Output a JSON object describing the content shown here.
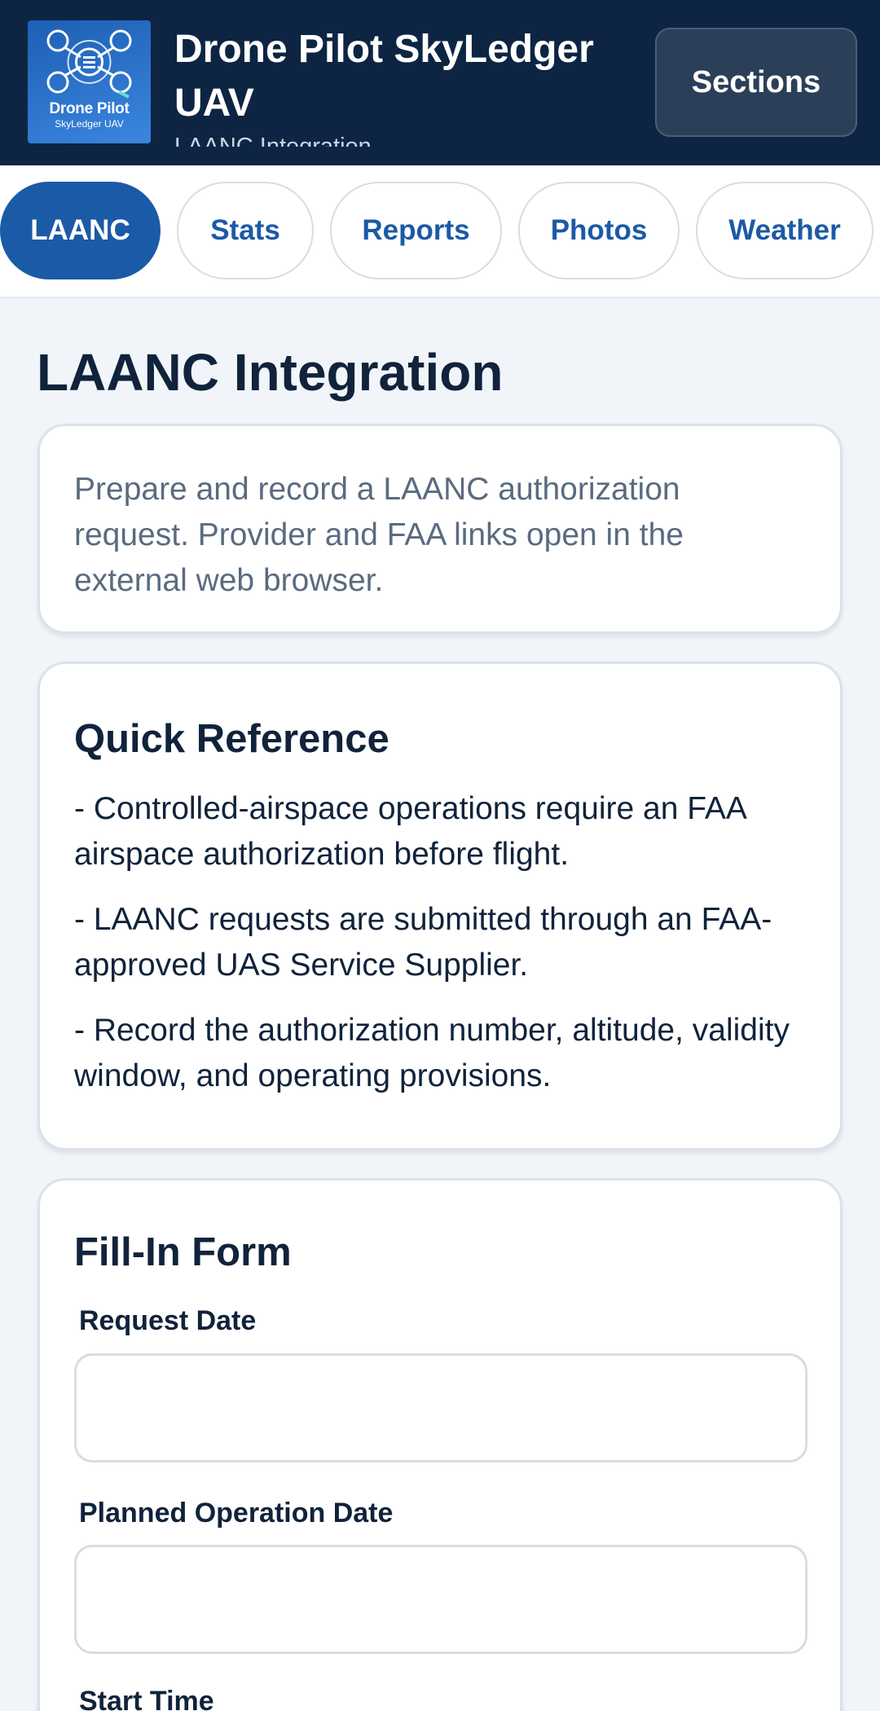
{
  "header": {
    "logo_title": "Drone Pilot",
    "logo_subtitle": "SkyLedger UAV",
    "app_title": "Drone Pilot SkyLedger UAV",
    "app_subtitle": "LAANC Integration",
    "sections_label": "Sections"
  },
  "tabs": [
    {
      "label": "LAANC",
      "active": true
    },
    {
      "label": "Stats",
      "active": false
    },
    {
      "label": "Reports",
      "active": false
    },
    {
      "label": "Photos",
      "active": false
    },
    {
      "label": "Weather",
      "active": false
    }
  ],
  "main": {
    "title": "LAANC Integration",
    "intro": "Prepare and record a LAANC authorization request. Provider and FAA links open in the external web browser.",
    "quick_reference": {
      "heading": "Quick Reference",
      "items": [
        "- Controlled-airspace operations require an FAA airspace authorization before flight.",
        "- LAANC requests are submitted through an FAA-approved UAS Service Supplier.",
        "- Record the authorization number, altitude, validity window, and operating provisions."
      ]
    },
    "form": {
      "heading": "Fill-In Form",
      "fields": [
        {
          "label": "Request Date",
          "value": ""
        },
        {
          "label": "Planned Operation Date",
          "value": ""
        },
        {
          "label": "Start Time",
          "value": ""
        }
      ]
    }
  },
  "colors": {
    "header_bg": "#0d2543",
    "accent": "#1b5aa6",
    "page_bg": "#f1f5f9"
  }
}
